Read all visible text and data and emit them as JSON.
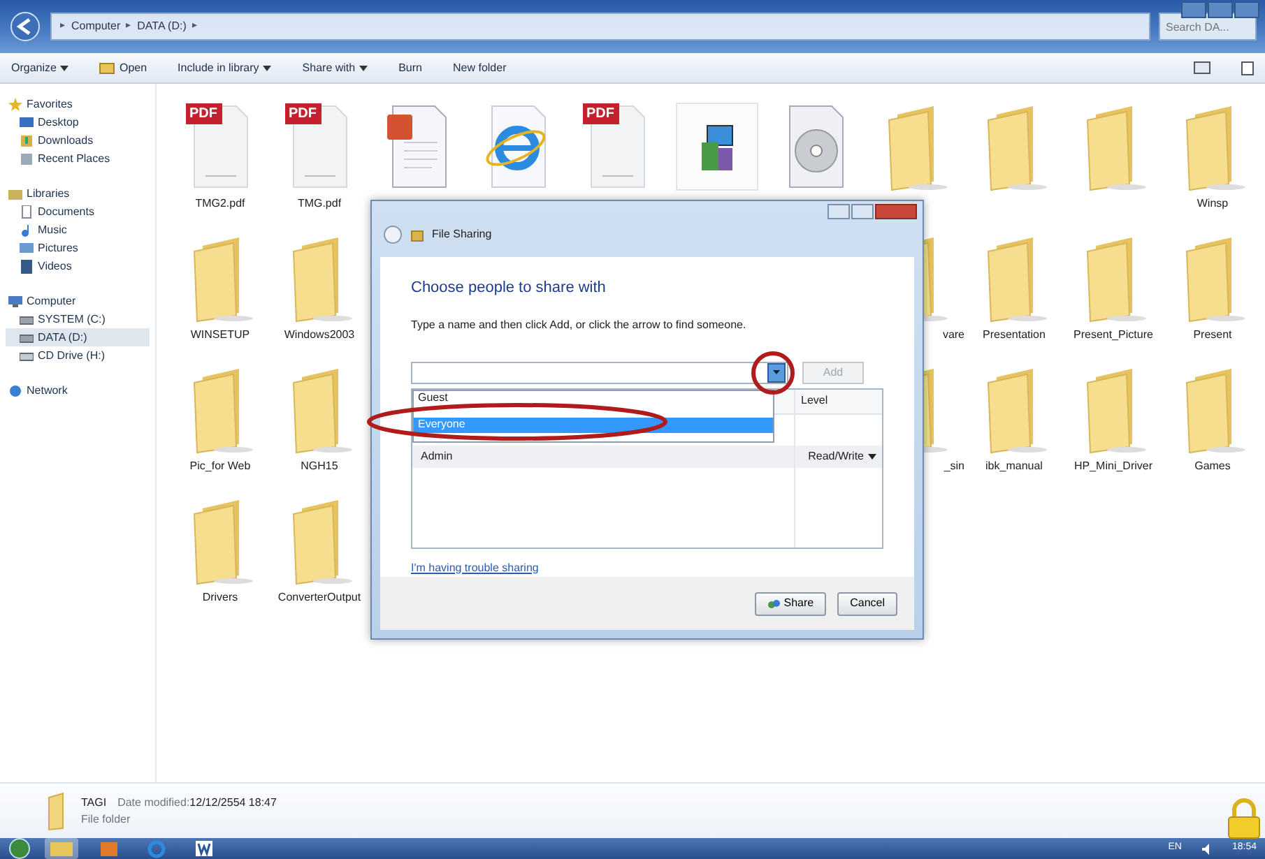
{
  "window": {
    "breadcrumb": [
      {
        "kind": "separator",
        "text": "▸"
      },
      {
        "kind": "segment",
        "text": "Computer"
      },
      {
        "kind": "separator",
        "text": "▸"
      },
      {
        "kind": "segment",
        "text": "DATA (D:)"
      },
      {
        "kind": "separator",
        "text": "▸"
      }
    ],
    "search": {
      "placeholder": "Search DA..."
    }
  },
  "toolbar": [
    {
      "label": "Organize",
      "dropdown": true
    },
    {
      "label": "Open",
      "dropdown": false
    },
    {
      "label": "Include in library",
      "dropdown": true
    },
    {
      "label": "Share with",
      "dropdown": true
    },
    {
      "label": "Burn",
      "dropdown": false
    },
    {
      "label": "New folder",
      "dropdown": false
    }
  ],
  "sidebar": [
    {
      "label": "Favorites",
      "selected": false,
      "children": [
        {
          "label": "Desktop",
          "selected": false
        },
        {
          "label": "Downloads",
          "selected": false
        },
        {
          "label": "Recent Places",
          "selected": false
        }
      ]
    },
    {
      "label": "Libraries",
      "selected": false,
      "children": [
        {
          "label": "Documents",
          "selected": false
        },
        {
          "label": "Music",
          "selected": false
        },
        {
          "label": "Pictures",
          "selected": false
        },
        {
          "label": "Videos",
          "selected": false
        }
      ]
    },
    {
      "label": "Computer",
      "selected": false,
      "children": [
        {
          "label": "SYSTEM (C:)",
          "selected": false
        },
        {
          "label": "DATA (D:)",
          "selected": true
        },
        {
          "label": "CD Drive (H:)",
          "selected": false
        }
      ]
    },
    {
      "label": "Network",
      "selected": false
    }
  ],
  "file_rows": [
    {
      "left": [
        {
          "kind": "pdf",
          "badge": "PDF",
          "label": "TMG2.pdf"
        },
        {
          "kind": "pdf",
          "badge": "PDF",
          "label": "TMG.pdf"
        },
        {
          "kind": "ppt"
        },
        {
          "kind": "ie"
        },
        {
          "kind": "pdf",
          "badge": "PDF"
        },
        {
          "kind": "installer"
        },
        {
          "kind": "disc"
        },
        {
          "kind": "folder"
        },
        {
          "kind": "folder"
        },
        {
          "kind": "folder"
        },
        {
          "kind": "folder",
          "label": "Winsp"
        }
      ],
      "right": []
    },
    {
      "left": [
        {
          "kind": "folder",
          "label": "WINSETUP"
        },
        {
          "kind": "folder",
          "label": "Windows2003"
        }
      ],
      "right": [
        {
          "kind": "folder",
          "label": "vare"
        },
        {
          "kind": "folder",
          "label": "Presentation"
        },
        {
          "kind": "folder",
          "label": "Present_Picture"
        },
        {
          "kind": "folder",
          "label": "Present"
        }
      ]
    },
    {
      "left": [
        {
          "kind": "folder",
          "label": "Pic_for Web"
        },
        {
          "kind": "folder",
          "label": "NGH15"
        }
      ],
      "right": [
        {
          "kind": "folder",
          "label": "_sin"
        },
        {
          "kind": "folder",
          "label": "ibk_manual"
        },
        {
          "kind": "folder",
          "label": "HP_Mini_Driver"
        },
        {
          "kind": "folder",
          "label": "Games"
        }
      ]
    },
    {
      "left": [
        {
          "kind": "folder",
          "label": "Drivers"
        },
        {
          "kind": "folder",
          "label": "ConverterOutput"
        }
      ],
      "right": []
    }
  ],
  "details": {
    "name": "TAGI",
    "date_label": "Date modified:",
    "date": "12/12/2554 18:47",
    "type": "File folder"
  },
  "dialog": {
    "title": "File Sharing",
    "heading": "Choose people to share with",
    "instruction": "Type a name and then click Add, or click the arrow to find someone.",
    "name_field": {
      "expanded": true
    },
    "add_button": {
      "label": "Add",
      "disabled": true
    },
    "dropdown_options": [
      {
        "label": "Guest",
        "selected": false
      },
      {
        "label": "Everyone",
        "selected": true
      }
    ],
    "table": {
      "columns": [
        "Level"
      ],
      "rows": [
        {
          "name": "Admin",
          "level": "Read/Write"
        }
      ]
    },
    "link": "I'm having trouble sharing",
    "buttons": [
      {
        "label": "Share",
        "kind": "share"
      },
      {
        "label": "Cancel",
        "kind": "plain"
      }
    ]
  },
  "annotations": [
    {
      "color": "#b01c1c"
    },
    {
      "color": "#b01c1c"
    }
  ],
  "taskbar": {
    "apps": [
      {
        "kind": "explorer",
        "selected": true
      },
      {
        "kind": "media",
        "selected": false
      },
      {
        "kind": "ie",
        "selected": false
      },
      {
        "kind": "word",
        "selected": false
      }
    ],
    "language": "EN",
    "clock": "18:54"
  }
}
